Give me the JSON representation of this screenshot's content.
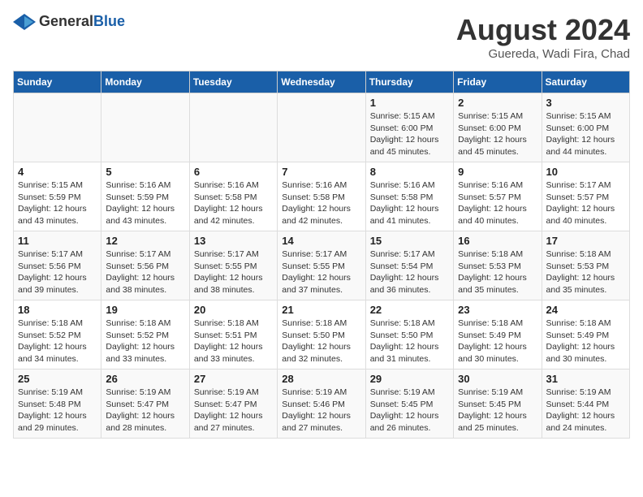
{
  "header": {
    "logo_general": "General",
    "logo_blue": "Blue",
    "title": "August 2024",
    "subtitle": "Guereda, Wadi Fira, Chad"
  },
  "days_of_week": [
    "Sunday",
    "Monday",
    "Tuesday",
    "Wednesday",
    "Thursday",
    "Friday",
    "Saturday"
  ],
  "weeks": [
    [
      {
        "day": "",
        "info": ""
      },
      {
        "day": "",
        "info": ""
      },
      {
        "day": "",
        "info": ""
      },
      {
        "day": "",
        "info": ""
      },
      {
        "day": "1",
        "info": "Sunrise: 5:15 AM\nSunset: 6:00 PM\nDaylight: 12 hours\nand 45 minutes."
      },
      {
        "day": "2",
        "info": "Sunrise: 5:15 AM\nSunset: 6:00 PM\nDaylight: 12 hours\nand 45 minutes."
      },
      {
        "day": "3",
        "info": "Sunrise: 5:15 AM\nSunset: 6:00 PM\nDaylight: 12 hours\nand 44 minutes."
      }
    ],
    [
      {
        "day": "4",
        "info": "Sunrise: 5:15 AM\nSunset: 5:59 PM\nDaylight: 12 hours\nand 43 minutes."
      },
      {
        "day": "5",
        "info": "Sunrise: 5:16 AM\nSunset: 5:59 PM\nDaylight: 12 hours\nand 43 minutes."
      },
      {
        "day": "6",
        "info": "Sunrise: 5:16 AM\nSunset: 5:58 PM\nDaylight: 12 hours\nand 42 minutes."
      },
      {
        "day": "7",
        "info": "Sunrise: 5:16 AM\nSunset: 5:58 PM\nDaylight: 12 hours\nand 42 minutes."
      },
      {
        "day": "8",
        "info": "Sunrise: 5:16 AM\nSunset: 5:58 PM\nDaylight: 12 hours\nand 41 minutes."
      },
      {
        "day": "9",
        "info": "Sunrise: 5:16 AM\nSunset: 5:57 PM\nDaylight: 12 hours\nand 40 minutes."
      },
      {
        "day": "10",
        "info": "Sunrise: 5:17 AM\nSunset: 5:57 PM\nDaylight: 12 hours\nand 40 minutes."
      }
    ],
    [
      {
        "day": "11",
        "info": "Sunrise: 5:17 AM\nSunset: 5:56 PM\nDaylight: 12 hours\nand 39 minutes."
      },
      {
        "day": "12",
        "info": "Sunrise: 5:17 AM\nSunset: 5:56 PM\nDaylight: 12 hours\nand 38 minutes."
      },
      {
        "day": "13",
        "info": "Sunrise: 5:17 AM\nSunset: 5:55 PM\nDaylight: 12 hours\nand 38 minutes."
      },
      {
        "day": "14",
        "info": "Sunrise: 5:17 AM\nSunset: 5:55 PM\nDaylight: 12 hours\nand 37 minutes."
      },
      {
        "day": "15",
        "info": "Sunrise: 5:17 AM\nSunset: 5:54 PM\nDaylight: 12 hours\nand 36 minutes."
      },
      {
        "day": "16",
        "info": "Sunrise: 5:18 AM\nSunset: 5:53 PM\nDaylight: 12 hours\nand 35 minutes."
      },
      {
        "day": "17",
        "info": "Sunrise: 5:18 AM\nSunset: 5:53 PM\nDaylight: 12 hours\nand 35 minutes."
      }
    ],
    [
      {
        "day": "18",
        "info": "Sunrise: 5:18 AM\nSunset: 5:52 PM\nDaylight: 12 hours\nand 34 minutes."
      },
      {
        "day": "19",
        "info": "Sunrise: 5:18 AM\nSunset: 5:52 PM\nDaylight: 12 hours\nand 33 minutes."
      },
      {
        "day": "20",
        "info": "Sunrise: 5:18 AM\nSunset: 5:51 PM\nDaylight: 12 hours\nand 33 minutes."
      },
      {
        "day": "21",
        "info": "Sunrise: 5:18 AM\nSunset: 5:50 PM\nDaylight: 12 hours\nand 32 minutes."
      },
      {
        "day": "22",
        "info": "Sunrise: 5:18 AM\nSunset: 5:50 PM\nDaylight: 12 hours\nand 31 minutes."
      },
      {
        "day": "23",
        "info": "Sunrise: 5:18 AM\nSunset: 5:49 PM\nDaylight: 12 hours\nand 30 minutes."
      },
      {
        "day": "24",
        "info": "Sunrise: 5:18 AM\nSunset: 5:49 PM\nDaylight: 12 hours\nand 30 minutes."
      }
    ],
    [
      {
        "day": "25",
        "info": "Sunrise: 5:19 AM\nSunset: 5:48 PM\nDaylight: 12 hours\nand 29 minutes."
      },
      {
        "day": "26",
        "info": "Sunrise: 5:19 AM\nSunset: 5:47 PM\nDaylight: 12 hours\nand 28 minutes."
      },
      {
        "day": "27",
        "info": "Sunrise: 5:19 AM\nSunset: 5:47 PM\nDaylight: 12 hours\nand 27 minutes."
      },
      {
        "day": "28",
        "info": "Sunrise: 5:19 AM\nSunset: 5:46 PM\nDaylight: 12 hours\nand 27 minutes."
      },
      {
        "day": "29",
        "info": "Sunrise: 5:19 AM\nSunset: 5:45 PM\nDaylight: 12 hours\nand 26 minutes."
      },
      {
        "day": "30",
        "info": "Sunrise: 5:19 AM\nSunset: 5:45 PM\nDaylight: 12 hours\nand 25 minutes."
      },
      {
        "day": "31",
        "info": "Sunrise: 5:19 AM\nSunset: 5:44 PM\nDaylight: 12 hours\nand 24 minutes."
      }
    ]
  ]
}
